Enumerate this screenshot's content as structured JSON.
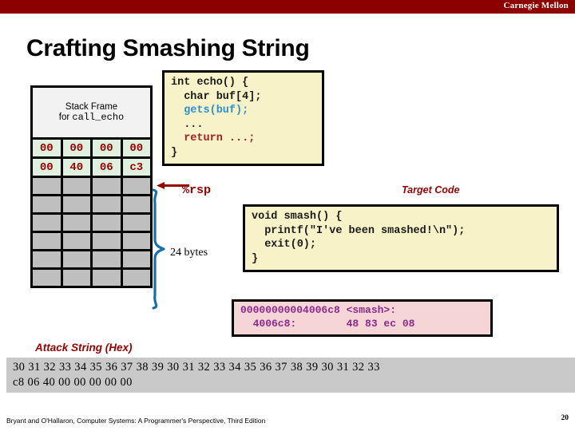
{
  "banner": {
    "institution": "Carnegie Mellon",
    "color": "#8c0000"
  },
  "slide": {
    "title": "Crafting Smashing String",
    "page_number": "20",
    "footer": "Bryant and O'Hallaron, Computer Systems: A Programmer's Perspective, Third Edition"
  },
  "stack": {
    "frame_header_line1": "Stack Frame",
    "frame_header_line2_prefix": "for ",
    "frame_header_line2_mono": "call_echo",
    "hex_rows": [
      [
        "00",
        "00",
        "00",
        "00"
      ],
      [
        "00",
        "40",
        "06",
        "c3"
      ]
    ],
    "gray_row_count": 6,
    "cell_fill_hex": "#dff0df",
    "cell_text_color": "#990000",
    "gray_fill": "#bfbfbf"
  },
  "annotations": {
    "rsp_label": "%rsp",
    "bytes_label": "24 bytes",
    "target_caption": "Target Code",
    "attack_caption": "Attack String (Hex)",
    "brace_color": "#1a6fa8",
    "arrow_color": "#990000"
  },
  "echo_code": {
    "lines": [
      {
        "text": "int echo() {",
        "style": "plain"
      },
      {
        "text": "  char buf[4];",
        "style": "plain"
      },
      {
        "text": "  gets(buf);",
        "style": "gets"
      },
      {
        "text": "  ...",
        "style": "plain"
      },
      {
        "text": "  return ...;",
        "style": "return"
      },
      {
        "text": "}",
        "style": "plain"
      }
    ],
    "bg": "#f7f2c8"
  },
  "target_code": {
    "lines": [
      "void smash() {",
      "  printf(\"I've been smashed!\\n\");",
      "  exit(0);",
      "}"
    ],
    "bg": "#f7f2c8"
  },
  "disassembly": {
    "line1": "00000000004006c8 <smash>:",
    "line2": "  4006c8:        48 83 ec 08",
    "bg": "#f6d5d7",
    "text_color": "#8b2a8b"
  },
  "attack_string": {
    "row1": "30 31 32 33 34 35 36 37 38 39 30 31 32 33 34 35 36 37 38 39 30 31 32 33",
    "row2": "c8 06 40 00 00 00 00 00",
    "band_bg": "#c9c9c9"
  }
}
